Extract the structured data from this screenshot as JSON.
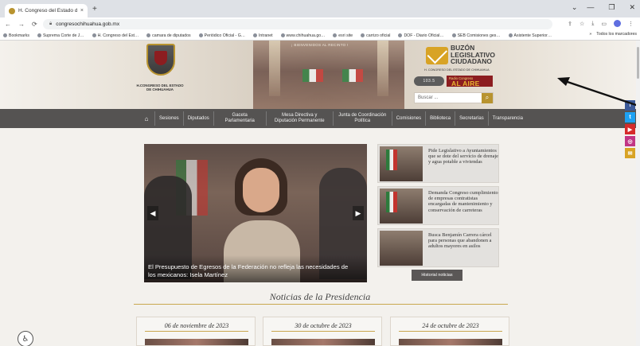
{
  "browser": {
    "tab_title": "H. Congreso del Estado de Chih",
    "tab_close": "×",
    "new_tab": "+",
    "url": "congresochihuahua.gob.mx",
    "window_controls": [
      "⌄",
      "—",
      "❐",
      "✕"
    ],
    "bookmarks": [
      "Bookmarks",
      "Suprema Corte de J…",
      "H. Congreso del Est…",
      "camara de diputados",
      "Periódico Oficial - G…",
      "Intranet",
      "www.chihuahua.go…",
      "esri site",
      "carrizo oficial",
      "DOF - Diario Oficial…",
      "SEB Comisiones ges…",
      "Asistente Superior…"
    ],
    "bookmarks_right": "Todos los marcadores"
  },
  "header": {
    "logo_text": "H.CONGRESO DEL ESTADO DE CHIHUAHUA",
    "hall_caption": "¡ BIENVENIDOS AL RECINTO !",
    "buzon_title": "BUZÓN LEGISLATIVO CIUDADANO",
    "buzon_sub": "H. CONGRESO DEL ESTADO DE CHIHUAHUA",
    "radio_pill": "103.5",
    "radio_small": "Radio Congreso",
    "radio_big": "AL AIRE",
    "search_placeholder": "Buscar ..."
  },
  "nav": {
    "items": [
      "Sesiones",
      "Diputados",
      "Gaceta Parlamentaria",
      "Mesa Directiva y Diputación Permanente",
      "Junta de Coordinación Política",
      "Comisiones",
      "Biblioteca",
      "Secretarías",
      "Transparencia"
    ]
  },
  "slider": {
    "caption": "El Presupuesto de Egresos de la Federación no refleja las necesidades de los mexicanos: Isela Martínez",
    "prev": "◀",
    "next": "▶"
  },
  "news": [
    "Pide Legislativo a Ayuntamientos que se dote del servicio de drenaje y agua potable a viviendas",
    "Demanda Congreso cumplimiento de empresas contratistas encargadas de mantenimiento y conservación de carreteras",
    "Busca Benjamín Carrera cárcel para personas que abandonen a adultos mayores en asilos"
  ],
  "historial_label": "Historial noticias",
  "section_title": "Noticias de la Presidencia",
  "cards": [
    "06 de noviembre de 2023",
    "30 de octubre de 2023",
    "24 de octubre de 2023"
  ],
  "social": [
    {
      "name": "facebook",
      "glyph": "f",
      "color": "#3b5998"
    },
    {
      "name": "twitter",
      "glyph": "t",
      "color": "#1da1f2"
    },
    {
      "name": "youtube",
      "glyph": "▶",
      "color": "#d62a2a"
    },
    {
      "name": "instagram",
      "glyph": "◎",
      "color": "#c13584"
    },
    {
      "name": "mail",
      "glyph": "✉",
      "color": "#d8a325"
    }
  ]
}
